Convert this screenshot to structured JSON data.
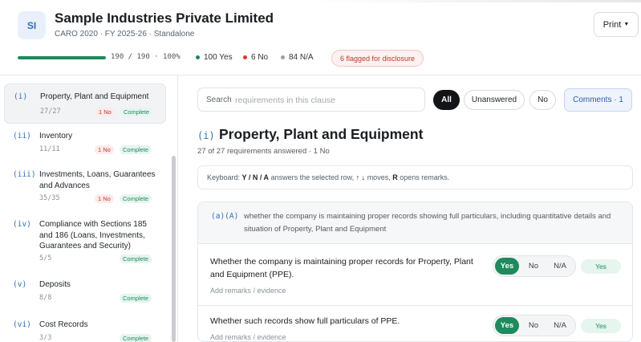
{
  "header": {
    "avatar_initials": "SI",
    "company_name": "Sample Industries Private Limited",
    "subtitle": "CARO 2020 · FY 2025-26 · Standalone",
    "print_label": "Print",
    "progress": {
      "text": "190 / 190 · 100%",
      "fraction": 1.0
    },
    "stats": {
      "yes": {
        "label": "100 Yes",
        "color": "#1e8a5d"
      },
      "no": {
        "label": "6 No",
        "color": "#d33a2c"
      },
      "na": {
        "label": "84 N/A",
        "color": "#9aa0a6"
      }
    },
    "flag_badge": "6 flagged for disclosure"
  },
  "sidebar": {
    "items": [
      {
        "num": "(i)",
        "title": "Property, Plant and Equipment",
        "count": "27/27",
        "no": "1 No",
        "status": "Complete",
        "active": true
      },
      {
        "num": "(ii)",
        "title": "Inventory",
        "count": "11/11",
        "no": "1 No",
        "status": "Complete"
      },
      {
        "num": "(iii)",
        "title": "Investments, Loans, Guarantees and Advances",
        "count": "35/35",
        "no": "1 No",
        "status": "Complete"
      },
      {
        "num": "(iv)",
        "title": "Compliance with Sections 185 and 186 (Loans, Investments, Guarantees and Security)",
        "count": "5/5",
        "status": "Complete"
      },
      {
        "num": "(v)",
        "title": "Deposits",
        "count": "8/8",
        "status": "Complete"
      },
      {
        "num": "(vi)",
        "title": "Cost Records",
        "count": "3/3",
        "status": "Complete"
      }
    ]
  },
  "toolbar": {
    "search_label": "Search",
    "search_placeholder": "requirements in this clause",
    "filters": [
      "All",
      "Unanswered",
      "No"
    ],
    "active_filter": "All",
    "comments_label": "Comments · 1"
  },
  "section": {
    "num": "(i)",
    "title": "Property, Plant and Equipment",
    "meta": "27 of 27 requirements answered · 1 No",
    "keyboard_prefix": "Keyboard:",
    "keyboard_keys": "Y / N / A",
    "keyboard_mid": "answers the selected row,",
    "keyboard_arrows": "↑ ↓",
    "keyboard_moves": "moves,",
    "keyboard_r": "R",
    "keyboard_suffix": "opens remarks."
  },
  "requirement": {
    "code": "(a)(A)",
    "description": "whether the company is maintaining proper records showing full particulars, including quantitative details and situation of Property, Plant and Equipment",
    "questions": [
      {
        "text": "Whether the company is maintaining proper records for Property, Plant and Equipment (PPE).",
        "remark_link": "Add remarks / evidence",
        "options": [
          "Yes",
          "No",
          "N/A"
        ],
        "selected": "Yes",
        "answer_badge": "Yes"
      },
      {
        "text": "Whether such records show full particulars of PPE.",
        "remark_link": "Add remarks / evidence",
        "options": [
          "Yes",
          "No",
          "N/A"
        ],
        "selected": "Yes",
        "answer_badge": "Yes"
      }
    ]
  }
}
